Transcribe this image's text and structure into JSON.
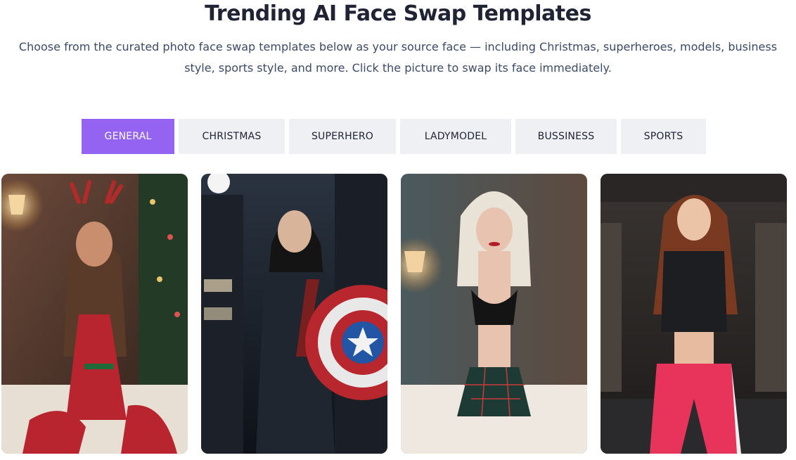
{
  "header": {
    "title": "Trending AI Face Swap Templates",
    "subtitle": "Choose from the curated photo face swap templates below as your source face — including Christmas, superheroes, models, business style, sports style, and more. Click the picture to swap its face immediately."
  },
  "tabs": [
    {
      "label": "GENERAL",
      "active": true
    },
    {
      "label": "CHRISTMAS",
      "active": false
    },
    {
      "label": "SUPERHERO",
      "active": false
    },
    {
      "label": "LADYMODEL",
      "active": false
    },
    {
      "label": "BUSSINESS",
      "active": false
    },
    {
      "label": "SPORTS",
      "active": false
    }
  ],
  "colors": {
    "accent": "#9563f2",
    "tab_bg": "#eff0f3",
    "title": "#1f2333",
    "subtitle": "#3b4a66"
  },
  "templates": [
    {
      "theme": "christmas"
    },
    {
      "theme": "superhero"
    },
    {
      "theme": "ladymodel"
    },
    {
      "theme": "sports"
    }
  ]
}
